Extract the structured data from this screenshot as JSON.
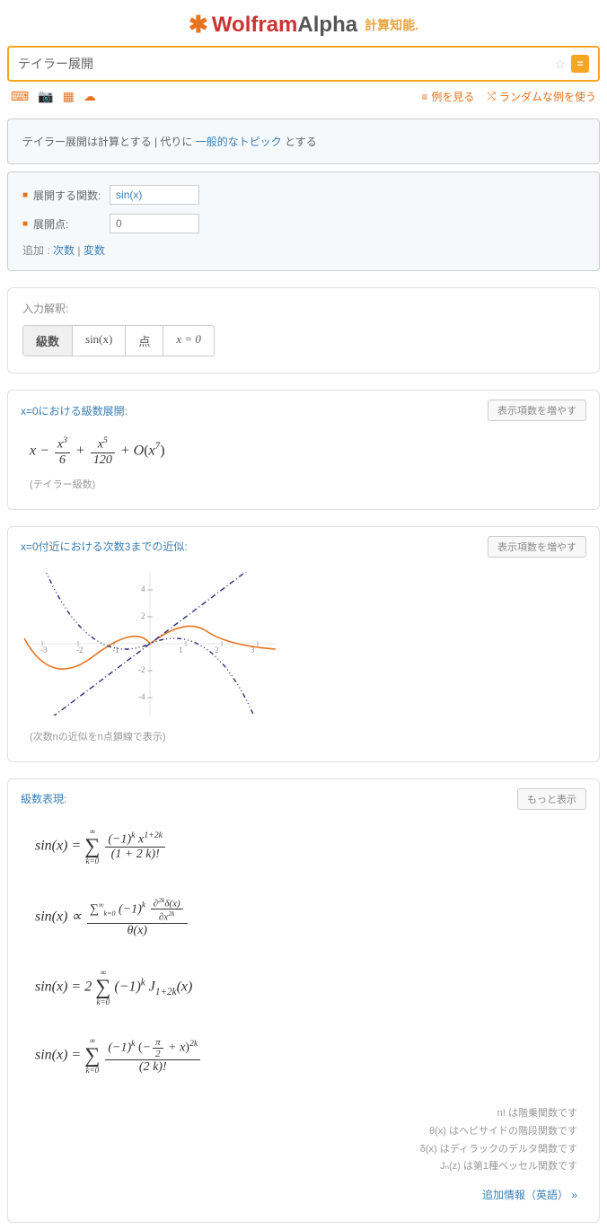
{
  "header": {
    "brand1": "Wolfram",
    "brand2": "Alpha",
    "tag": "計算知能."
  },
  "search": {
    "query": "テイラー展開",
    "star": "☆",
    "go": "="
  },
  "toolbar": {
    "examples": "例を見る",
    "random": "ランダムな例を使う"
  },
  "hint": {
    "prefix": "テイラー展開は計算とする | 代りに ",
    "link": "一般的なトピック",
    "suffix": " とする"
  },
  "params": {
    "func_label": "展開する関数:",
    "func_value": "sin(x)",
    "point_label": "展開点:",
    "point_placeholder": "0",
    "add_label": "追加 : ",
    "add1": "次数",
    "add2": "変数"
  },
  "interp": {
    "title": "入力解釈:",
    "cells": [
      "級数",
      "sin(x)",
      "点",
      "x = 0"
    ]
  },
  "pod1": {
    "title": "x=0における級数展開:",
    "btn": "表示項数を増やす",
    "caption": "(テイラー級数)"
  },
  "pod2": {
    "title": "x=0付近における次数3までの近似:",
    "btn": "表示項数を増やす",
    "caption": "(次数nの近似をn点鎖線で表示)"
  },
  "pod3": {
    "title": "級数表現:",
    "btn": "もっと表示"
  },
  "chart_data": {
    "type": "line",
    "xlim": [
      -3.5,
      3.5
    ],
    "ylim": [
      -5,
      5
    ],
    "xticks": [
      -3,
      -2,
      -1,
      1,
      2,
      3
    ],
    "yticks": [
      -4,
      -2,
      2,
      4
    ],
    "series": [
      {
        "name": "sin(x)",
        "color": "#e8731e",
        "style": "solid",
        "fn": "sin"
      },
      {
        "name": "order1",
        "color": "#3a3a8a",
        "style": "dash1",
        "fn": "x"
      },
      {
        "name": "order3",
        "color": "#3a3a8a",
        "style": "dash3",
        "fn": "x - x^3/6"
      }
    ]
  },
  "notes": {
    "n1": "n! は階乗関数です",
    "n2": "θ(x) はヘビサイドの階段関数です",
    "n3": "δ(x) はディラックのデルタ関数です",
    "n4": "Jₙ(z) は第1種ベッセル関数です"
  },
  "extra": {
    "link": "追加情報（英語）  »"
  }
}
